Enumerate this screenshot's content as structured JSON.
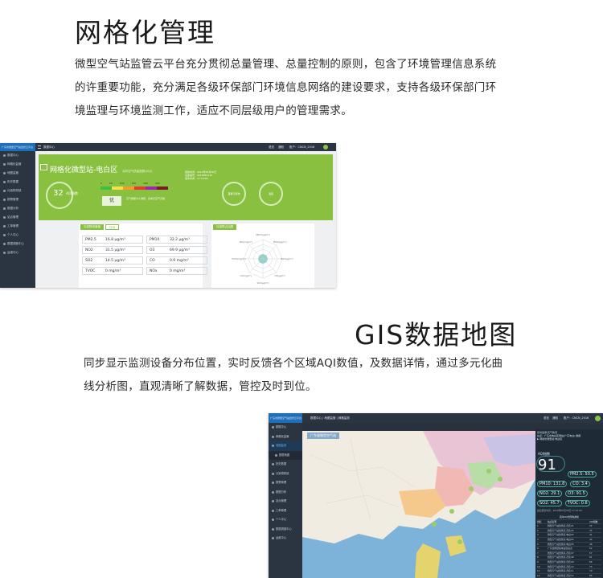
{
  "section1": {
    "heading": "网格化管理",
    "paragraph_lines": [
      "微型空气站监管云平台充分贯彻总量管理、总量控制的原则，包含了环境管理信息系统",
      "的许重要功能，充分满足各级环保部门环境信息网络的建设要求，支持各级环保部门环",
      "境监理与环境监测工作，适应不同层级用户的管理需求。"
    ]
  },
  "screenshot1": {
    "brand": "广东省微型空气站监管云平台",
    "topbar": {
      "breadcrumb": "数据中心",
      "user_label": "账户：",
      "user_name": "CNCN_2016",
      "lang": "语言",
      "bell": "通知"
    },
    "sidebar": [
      "数据中心",
      "网格化监管",
      "地图监管",
      "历史数据",
      "污染物排放",
      "报警管理",
      "数据分析",
      "站点管理",
      "工单管理",
      "个人中心",
      "数据调度中心",
      "运维中心"
    ],
    "banner": {
      "title": "网格化微型站-电白区",
      "subtitle": "实时空气质量指数(AQI)",
      "aqi_value": "32",
      "aqi_label": "AQI指数",
      "scale_labels": [
        "0",
        "50",
        "100",
        "150",
        "200",
        "300"
      ],
      "scale_colors": [
        "#3fbf3f",
        "#f3e34a",
        "#f39b2c",
        "#e53935",
        "#9c27b0",
        "#7b1b24"
      ],
      "level": "优",
      "level_note": "空气质量令人满意，基本无空气污染",
      "info": [
        "更新时间：2019年05月30日",
        "设备编号：2019050110",
        "发布时间：17:10:00"
      ],
      "ring2": "首要污染物",
      "ring3": "温度"
    },
    "cards": {
      "left_tabs": [
        "污染物浓度值",
        "日均"
      ],
      "right_tabs": [
        "污染物占比图"
      ]
    },
    "metrics": [
      {
        "name": "PM2.5",
        "value": "16.8 μg/m³"
      },
      {
        "name": "PM10",
        "value": "32.2 μg/m³"
      },
      {
        "name": "NO2",
        "value": "31.5 μg/m³"
      },
      {
        "name": "O3",
        "value": "69.9 μg/m³"
      },
      {
        "name": "SO2",
        "value": "14.5 μg/m³"
      },
      {
        "name": "CO",
        "value": "0.9 mg/m³"
      },
      {
        "name": "TVOC",
        "value": "0 mg/m³"
      },
      {
        "name": "NOx",
        "value": "0 mg/m³"
      }
    ],
    "radar_labels": [
      "PM2.5(μg/m³)",
      "PM10(μg/m³)",
      "NO2(μg/m³)",
      "O3(μg/m³)",
      "SO2(μg/m³)",
      "CO(mg/m³)",
      "TVOC(mg/m³)",
      "NOx(mg/m³)"
    ]
  },
  "section2": {
    "heading": "GIS数据地图",
    "paragraph_lines": [
      "同步显示监测设备分布位置，实时反馈各个区域AQI数值，及数据详情，通过多元化曲",
      "线分析图，直观清晰了解数据，管控及时到位。"
    ]
  },
  "screenshot2": {
    "brand": "广东省微型空气站监管云平台",
    "topbar": {
      "breadcrumb": "数据中心 | 地图监管 | 网格监测",
      "user_label": "账户：",
      "user_name": "CNCN_2016",
      "lang": "语言",
      "bell": "通知"
    },
    "sidebar": [
      "数据中心",
      "网格化监管",
      "地图监测",
      "数据地图",
      "历史数据",
      "污染物排放",
      "报警管理",
      "数据分析",
      "站点管理",
      "工单管理",
      "个人中心",
      "数据调度中心",
      "运维中心"
    ],
    "map_tag": "广东省微型空气站",
    "panel": {
      "head": [
        "实时监测/天气情况",
        "站点：广东省电白区微站(广东电白)·数据",
        "▶ 网格化微型站-电白区"
      ],
      "aqi_label": "AQI指数",
      "aqi_value": "91",
      "readings": [
        [
          "PM2.5: 50.5"
        ],
        [
          "PM10: 131.8",
          "CO: 3.4"
        ],
        [
          "NO2: 29.1",
          "O3: 91.5"
        ],
        [
          "SO2: 45.7",
          "TVOC: 0.6"
        ]
      ],
      "update": "最后更新时间：2019年05月30日 17:10:00",
      "table_title": "实时AQI监测站排名",
      "table_header": [
        "排名",
        "站点名称",
        "AQI指数"
      ],
      "table_rows": [
        [
          "1",
          "微型空气站监测点-茂名01",
          "32"
        ],
        [
          "2",
          "微型空气站监测点-茂名02",
          "35"
        ],
        [
          "3",
          "微型空气站监测点-电白03",
          "41"
        ],
        [
          "4",
          "微型空气站监测点-电白04",
          "44"
        ],
        [
          "5",
          "微型空气站监测点-电白05",
          "48"
        ],
        [
          "6",
          "广东省微型站电白区站点",
          "52"
        ],
        [
          "7",
          "微型空气站监测点-茂名07",
          "57"
        ],
        [
          "8",
          "微型空气站监测点-茂名08",
          "61"
        ],
        [
          "9",
          "微型空气站监测点-茂名09",
          "66"
        ],
        [
          "10",
          "微型空气站监测点-茂名10",
          "73"
        ],
        [
          "11",
          "微型空气站监测点-茂名11",
          "79"
        ],
        [
          "12",
          "微型空气站监测点-茂名12",
          "85"
        ],
        [
          "13",
          "微型空气站监测点-茂名13",
          "91"
        ]
      ]
    }
  }
}
